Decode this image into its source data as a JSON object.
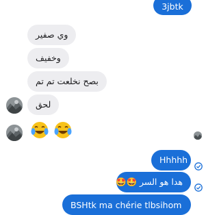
{
  "messages": {
    "m0": "3jbtk",
    "m1": "وي صفير",
    "m2": "وخفيف",
    "m3": "بصح نخلعت تم تم",
    "m4": "لحق",
    "m6": "Hhhhh",
    "m7": "هدا هو السر 🤩🤩",
    "m8": "BSHtk ma chérie tlbsihom"
  },
  "icons": {
    "reaction": "face-with-tears-of-joy",
    "avatar": "contact-avatar-photo",
    "seen": "read-receipt-check"
  },
  "colors": {
    "outgoing_bubble": "#1a6fd8",
    "incoming_bubble": "#ededf0",
    "read_receipt": "#1a6fd8"
  }
}
